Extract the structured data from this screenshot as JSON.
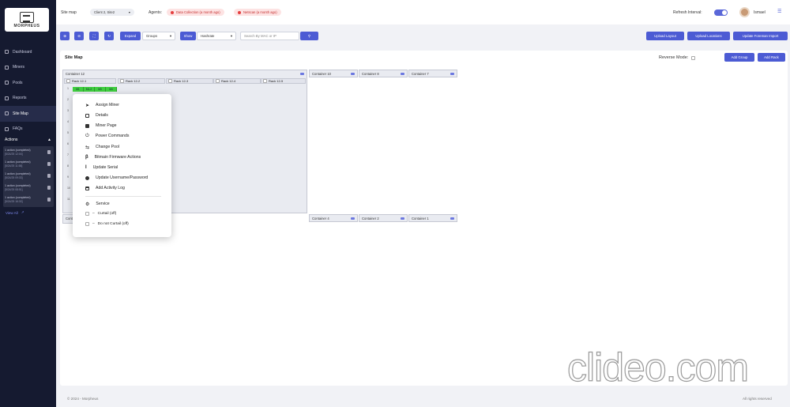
{
  "sidebar": {
    "logo_text": "MORPHEUS",
    "items": [
      {
        "label": "Dashboard",
        "icon": "home-icon"
      },
      {
        "label": "Miners",
        "icon": "cpu-icon"
      },
      {
        "label": "Pools",
        "icon": "pool-icon"
      },
      {
        "label": "Reports",
        "icon": "report-icon"
      },
      {
        "label": "Site Map",
        "icon": "map-icon"
      },
      {
        "label": "FAQs",
        "icon": "help-icon"
      }
    ],
    "actions_title": "Actions",
    "actions": [
      {
        "title": "1 action (completed)",
        "time": "[5/24/25 12:04]"
      },
      {
        "title": "1 action (completed)",
        "time": "[5/24/25 11:58]"
      },
      {
        "title": "1 action (completed)",
        "time": "[5/24/25 09:33]"
      },
      {
        "title": "1 action (completed)",
        "time": "[5/24/25 08:51]"
      },
      {
        "title": "1 action (completed)",
        "time": "[5/24/25 16:30]"
      }
    ],
    "view_all": "View All"
  },
  "header": {
    "breadcrumb": "Site map",
    "client_select": "Client 2, Site2",
    "agents_label": "Agents:",
    "agents": [
      {
        "label": "Data Collection (a month ago)"
      },
      {
        "label": "Netscan (a month ago)"
      }
    ],
    "refresh_label": "Refresh Interval:",
    "user": "Ismael"
  },
  "toolbar": {
    "expand": "Expand",
    "groups": "Groups",
    "show": "Show",
    "hashrate": "Hashrate",
    "search_placeholder": "Search By MAC or IP",
    "upload_layout": "Upload Layout",
    "upload_locations": "Upload Locations",
    "update_foreman": "Update Foreman Import"
  },
  "sitemap": {
    "title": "Site Map",
    "reverse_mode": "Reverse Mode:",
    "add_group": "Add Group",
    "add_rack": "Add Rack",
    "container_12": "Container 12",
    "racks": [
      "Rack 12-1",
      "Rack 12-2",
      "Rack 12-3",
      "Rack 12-4",
      "Rack 12-5"
    ],
    "row_numbers": [
      "1",
      "2",
      "3",
      "4",
      "5",
      "6",
      "7",
      "8",
      "9",
      "10",
      "11"
    ],
    "miners": [
      "M1",
      "M1-2",
      "M3",
      "M4"
    ],
    "top_containers": [
      "Container 10",
      "Container 8",
      "Container 7"
    ],
    "bottom_containers": [
      "Container 4",
      "Container 2",
      "Container 1"
    ],
    "bottom_left": "Cont"
  },
  "context_menu": {
    "items": [
      {
        "label": "Assign Miner",
        "icon": "cursor-icon"
      },
      {
        "label": "Details",
        "icon": "edit-icon"
      },
      {
        "label": "Miner Page",
        "icon": "list-icon"
      },
      {
        "label": "Power Commands",
        "icon": "power-icon"
      },
      {
        "label": "Change Pool",
        "icon": "swap-icon"
      },
      {
        "label": "Bitmain Firmware Actions",
        "icon": "bitmain-icon"
      },
      {
        "label": "Update Serial",
        "icon": "serial-icon"
      },
      {
        "label": "Update Username/Password",
        "icon": "user-lock-icon"
      },
      {
        "label": "Add Activity Log",
        "icon": "calendar-icon"
      }
    ],
    "service_label": "Service",
    "curtail_on": "Curtail (off)",
    "curtail_off": "Do not Curtail (off)"
  },
  "footer": {
    "copyright": "© 2024 - Morpheus",
    "rights": "All rights reserved"
  },
  "watermark": "clideo.com"
}
